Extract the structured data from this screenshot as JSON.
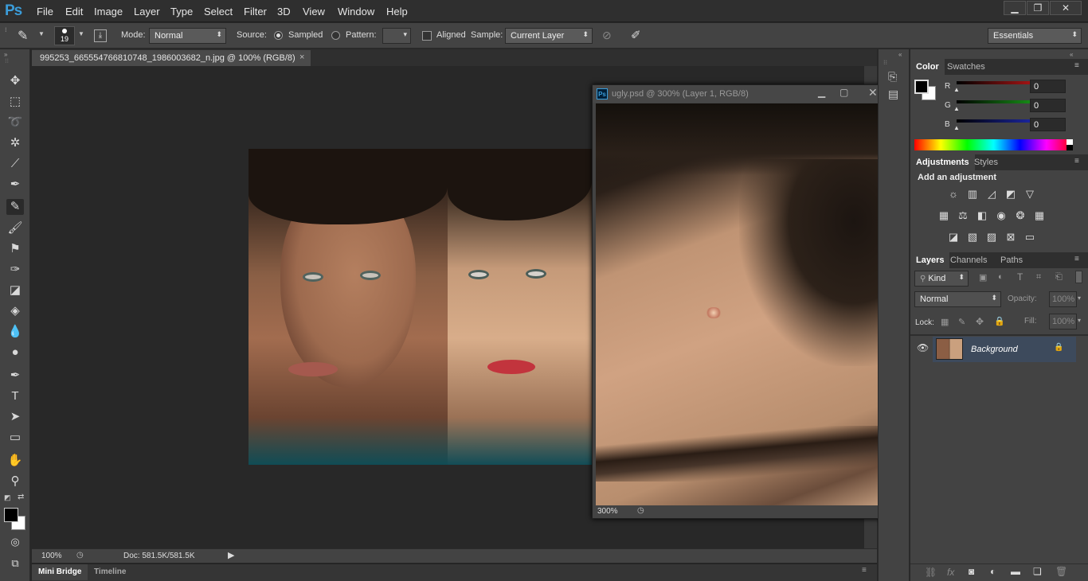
{
  "app": {
    "logo": "Ps"
  },
  "menu": [
    "File",
    "Edit",
    "Image",
    "Layer",
    "Type",
    "Select",
    "Filter",
    "3D",
    "View",
    "Window",
    "Help"
  ],
  "window_controls": {
    "minimize": "▁",
    "restore": "❐",
    "close": "✕"
  },
  "options_bar": {
    "brush_size": "19",
    "mode_label": "Mode:",
    "mode_value": "Normal",
    "source_label": "Source:",
    "sampled_label": "Sampled",
    "pattern_label": "Pattern:",
    "aligned_label": "Aligned",
    "sample_label": "Sample:",
    "sample_value": "Current Layer",
    "workspace": "Essentials"
  },
  "document": {
    "tab_title": "995253_665554766810748_1986003682_n.jpg @ 100% (RGB/8)",
    "tab_close": "×",
    "zoom": "100%",
    "doc_info": "Doc: 581.5K/581.5K"
  },
  "floating_doc": {
    "title": "ugly.psd @ 300% (Layer 1, RGB/8)",
    "zoom": "300%"
  },
  "bottom_tabs": [
    "Mini Bridge",
    "Timeline"
  ],
  "color_panel": {
    "tabs": [
      "Color",
      "Swatches"
    ],
    "channels": [
      {
        "label": "R",
        "value": "0",
        "color": "#e01b1b"
      },
      {
        "label": "G",
        "value": "0",
        "color": "#1fbf1f"
      },
      {
        "label": "B",
        "value": "0",
        "color": "#2433d8"
      }
    ]
  },
  "adjustments_panel": {
    "tabs": [
      "Adjustments",
      "Styles"
    ],
    "heading": "Add an adjustment"
  },
  "layers_panel": {
    "tabs": [
      "Layers",
      "Channels",
      "Paths"
    ],
    "filter": "Kind",
    "blend_mode": "Normal",
    "opacity_label": "Opacity:",
    "opacity_value": "100%",
    "lock_label": "Lock:",
    "fill_label": "Fill:",
    "fill_value": "100%",
    "layers": [
      {
        "name": "Background",
        "visible": true,
        "locked": true
      }
    ]
  },
  "colors": {
    "accent": "#3b9cd9",
    "selected_layer": "#3d4a5c"
  }
}
